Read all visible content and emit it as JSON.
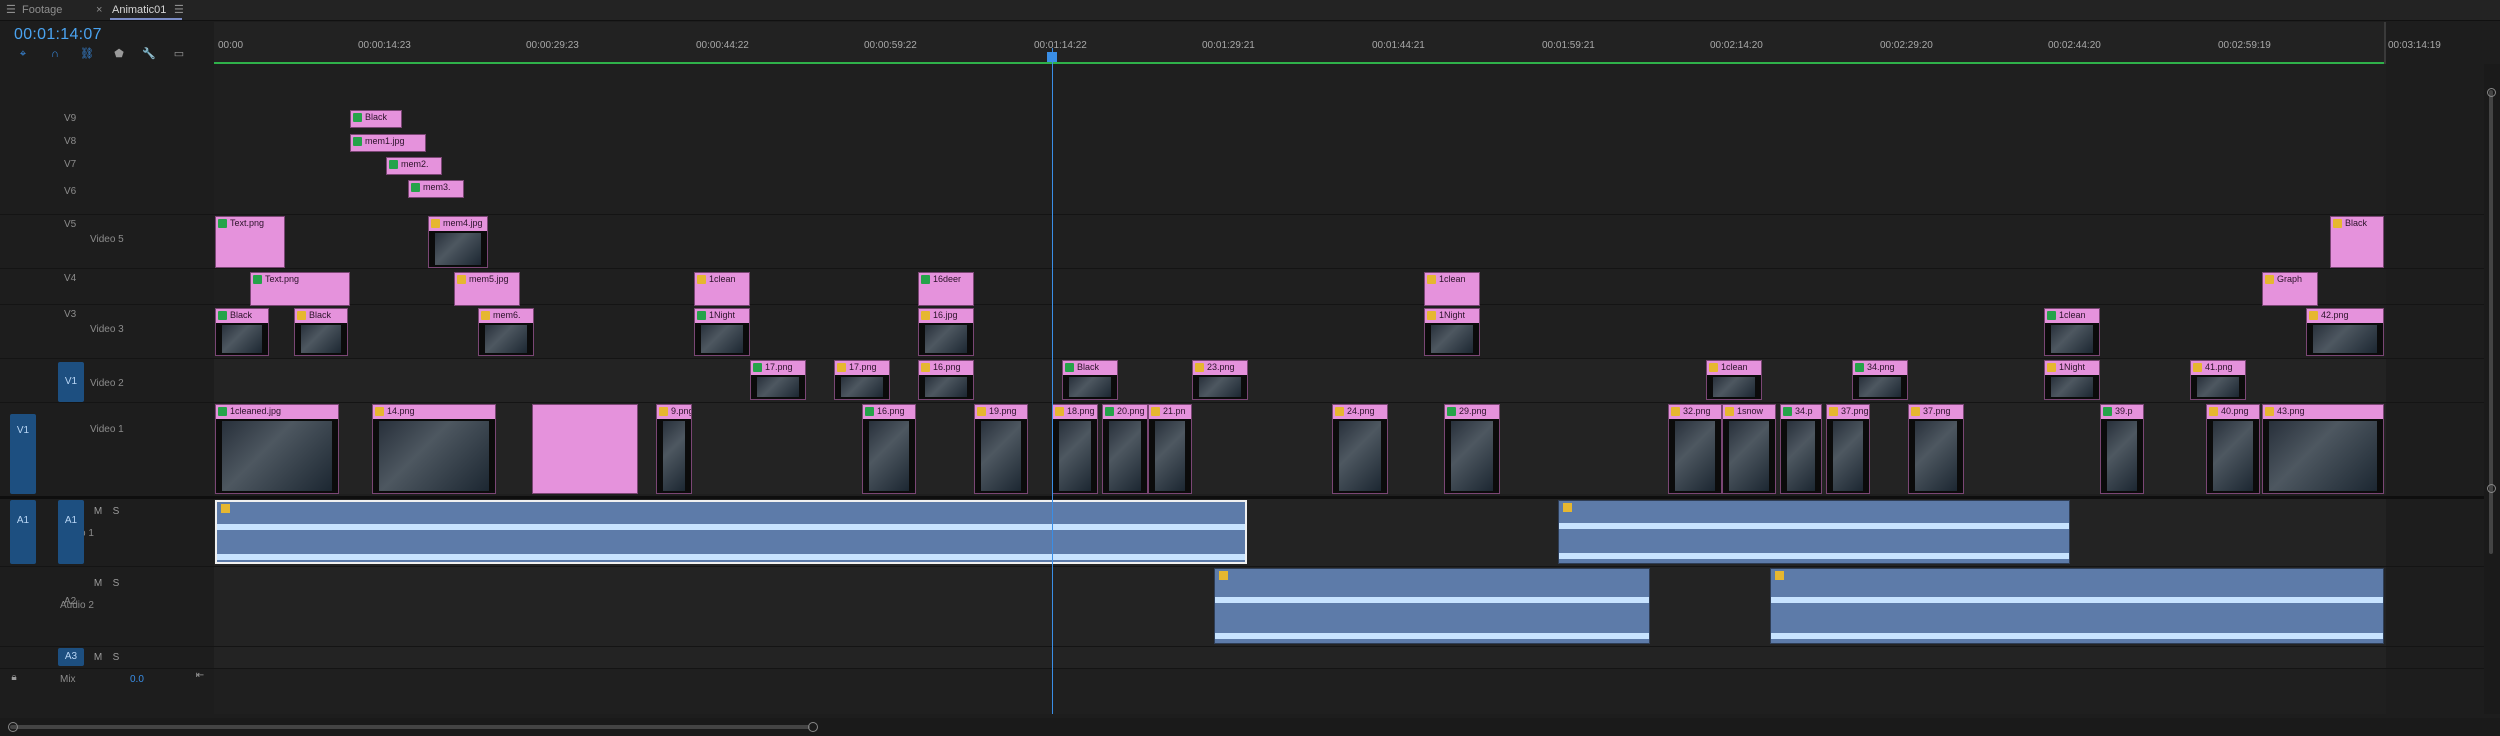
{
  "tabs": [
    {
      "label": "Footage",
      "active": false
    },
    {
      "label": "Animatic01",
      "active": true
    }
  ],
  "timecode": "00:01:14:07",
  "ruler_labels": [
    "00:00",
    "00:00:14:23",
    "00:00:29:23",
    "00:00:44:22",
    "00:00:59:22",
    "00:01:14:22",
    "00:01:29:21",
    "00:01:44:21",
    "00:01:59:21",
    "00:02:14:20",
    "00:02:29:20",
    "00:02:44:20",
    "00:02:59:19",
    "00:03:14:19"
  ],
  "video_tracks": [
    {
      "id": "V9",
      "name": ""
    },
    {
      "id": "V8",
      "name": ""
    },
    {
      "id": "V7",
      "name": ""
    },
    {
      "id": "V6",
      "name": ""
    },
    {
      "id": "V5",
      "name": "Video 5"
    },
    {
      "id": "V4",
      "name": ""
    },
    {
      "id": "V3",
      "name": "Video 3"
    },
    {
      "id": "V2",
      "name": "Video 2"
    },
    {
      "id": "V1",
      "name": "Video 1"
    }
  ],
  "source_patch_v": "V1",
  "source_patch_a": "A1",
  "audio_tracks": [
    {
      "id": "A1",
      "name": "Audio 1"
    },
    {
      "id": "A2",
      "name": "Audio 2"
    },
    {
      "id": "A3",
      "name": ""
    }
  ],
  "mix": {
    "label": "Mix",
    "value": "0.0"
  },
  "track_buttons": {
    "mute": "M",
    "solo": "S"
  },
  "clips": {
    "v9": [
      "Black"
    ],
    "v8": [
      "mem1.jpg"
    ],
    "v7": [
      "mem2."
    ],
    "v6": [
      "mem3."
    ],
    "v5": [
      "Text.png",
      "mem4.jpg",
      "Black"
    ],
    "v4": [
      "Text.png",
      "mem5.jpg",
      "1clean",
      "16deer",
      "1clean",
      "Graph"
    ],
    "v3": [
      "Black",
      "Black",
      "mem6.",
      "1Night",
      "16.jpg",
      "1Night",
      "1clean",
      "42.png"
    ],
    "v2": [
      "17.png",
      "17.png",
      "16.png",
      "Black",
      "23.png",
      "1clean",
      "34.png",
      "1Night",
      "41.png"
    ],
    "v1": [
      "1cleaned.jpg",
      "14.png",
      "9.png",
      "16.png",
      "19.png",
      "18.png",
      "20.png",
      "21.pn",
      "24.png",
      "29.png",
      "32.png",
      "1snow",
      "34.p",
      "37.png",
      "37.png",
      "39.p",
      "40.png",
      "43.png"
    ]
  }
}
